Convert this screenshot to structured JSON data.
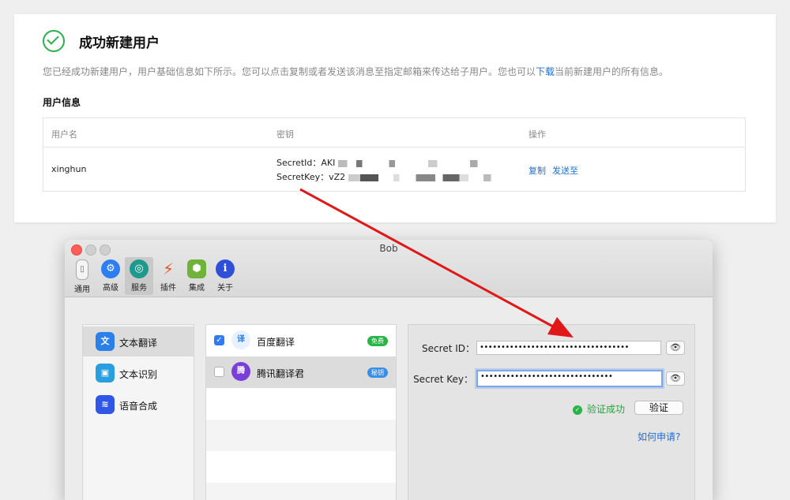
{
  "panel": {
    "title": "成功新建用户",
    "desc_prefix": "您已经成功新建用户，用户基础信息如下所示。您可以点击复制或者发送该消息至指定邮箱来传达给子用户。您也可以",
    "desc_link": "下载",
    "desc_suffix": "当前新建用户的所有信息。",
    "section": "用户信息",
    "table": {
      "headers": [
        "用户名",
        "密钥",
        "操作"
      ],
      "row": {
        "username": "xinghun",
        "secret_id_label": "SecretId：",
        "secret_id_value": "AKI",
        "secret_key_label": "SecretKey：",
        "secret_key_value": "vZ2",
        "action_copy": "复制",
        "action_send": "发送至"
      }
    }
  },
  "window": {
    "title": "Bob",
    "toolbar": [
      {
        "label": "通用",
        "icon": "switch-icon",
        "color": "#9a9a9a"
      },
      {
        "label": "高级",
        "icon": "gear-icon",
        "color": "#2d7ef0"
      },
      {
        "label": "服务",
        "icon": "service-icon",
        "color": "#1d9a8d"
      },
      {
        "label": "插件",
        "icon": "plug-icon",
        "color": "#e2572c"
      },
      {
        "label": "集成",
        "icon": "cube-icon",
        "color": "#6fb33a"
      },
      {
        "label": "关于",
        "icon": "info-icon",
        "color": "#2e4fd8"
      }
    ],
    "sidebar": [
      {
        "label": "文本翻译",
        "icon": "translate-icon",
        "color": "#2b7fea"
      },
      {
        "label": "文本识别",
        "icon": "image-icon",
        "color": "#2a9fe0"
      },
      {
        "label": "语音合成",
        "icon": "speech-icon",
        "color": "#2f56e6"
      }
    ],
    "services": [
      {
        "name": "百度翻译",
        "tag": "免费",
        "tag_color": "#28b446",
        "checked": true
      },
      {
        "name": "腾讯翻译君",
        "tag": "秘钥",
        "tag_color": "#3a8ee6",
        "checked": false
      }
    ],
    "form": {
      "secret_id_label": "Secret ID：",
      "secret_id_value": "•••••••••••••••••••••••••••••••••••",
      "secret_key_label": "Secret Key：",
      "secret_key_value": "•••••••••••••••••••••••••••••••",
      "verify_status": "验证成功",
      "verify_button": "验证",
      "howto_link": "如何申请?"
    },
    "colors": {
      "accent": "#1b6fd0",
      "success": "#27b148",
      "arrow": "#e01818"
    }
  }
}
